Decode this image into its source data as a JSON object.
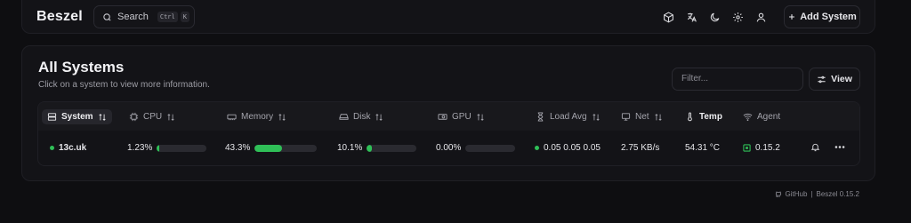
{
  "app": {
    "logo": "Beszel"
  },
  "search": {
    "label": "Search",
    "keys": [
      "Ctrl",
      "K"
    ]
  },
  "header": {
    "add_system": "Add System"
  },
  "systems_card": {
    "title": "All Systems",
    "subtitle": "Click on a system to view more information.",
    "filter_placeholder": "Filter...",
    "view_label": "View"
  },
  "columns": {
    "system": "System",
    "cpu": "CPU",
    "memory": "Memory",
    "disk": "Disk",
    "gpu": "GPU",
    "load_avg": "Load Avg",
    "net": "Net",
    "temp": "Temp",
    "agent": "Agent"
  },
  "rows": [
    {
      "name": "13c.uk",
      "status_color": "#2fbf57",
      "cpu": "1.23%",
      "cpu_fraction": 0.0123,
      "memory": "43.3%",
      "memory_fraction": 0.433,
      "disk": "10.1%",
      "disk_fraction": 0.101,
      "gpu": "0.00%",
      "gpu_fraction": 0.0,
      "load_avg": "0.05 0.05 0.05",
      "net": "2.75 KB/s",
      "temp": "54.31 °C",
      "agent": "0.15.2"
    }
  ],
  "footer": {
    "github": "GitHub",
    "separator": "|",
    "version": "Beszel 0.15.2"
  },
  "colors": {
    "accent": "#2fbf57",
    "background": "#0e0e11"
  }
}
